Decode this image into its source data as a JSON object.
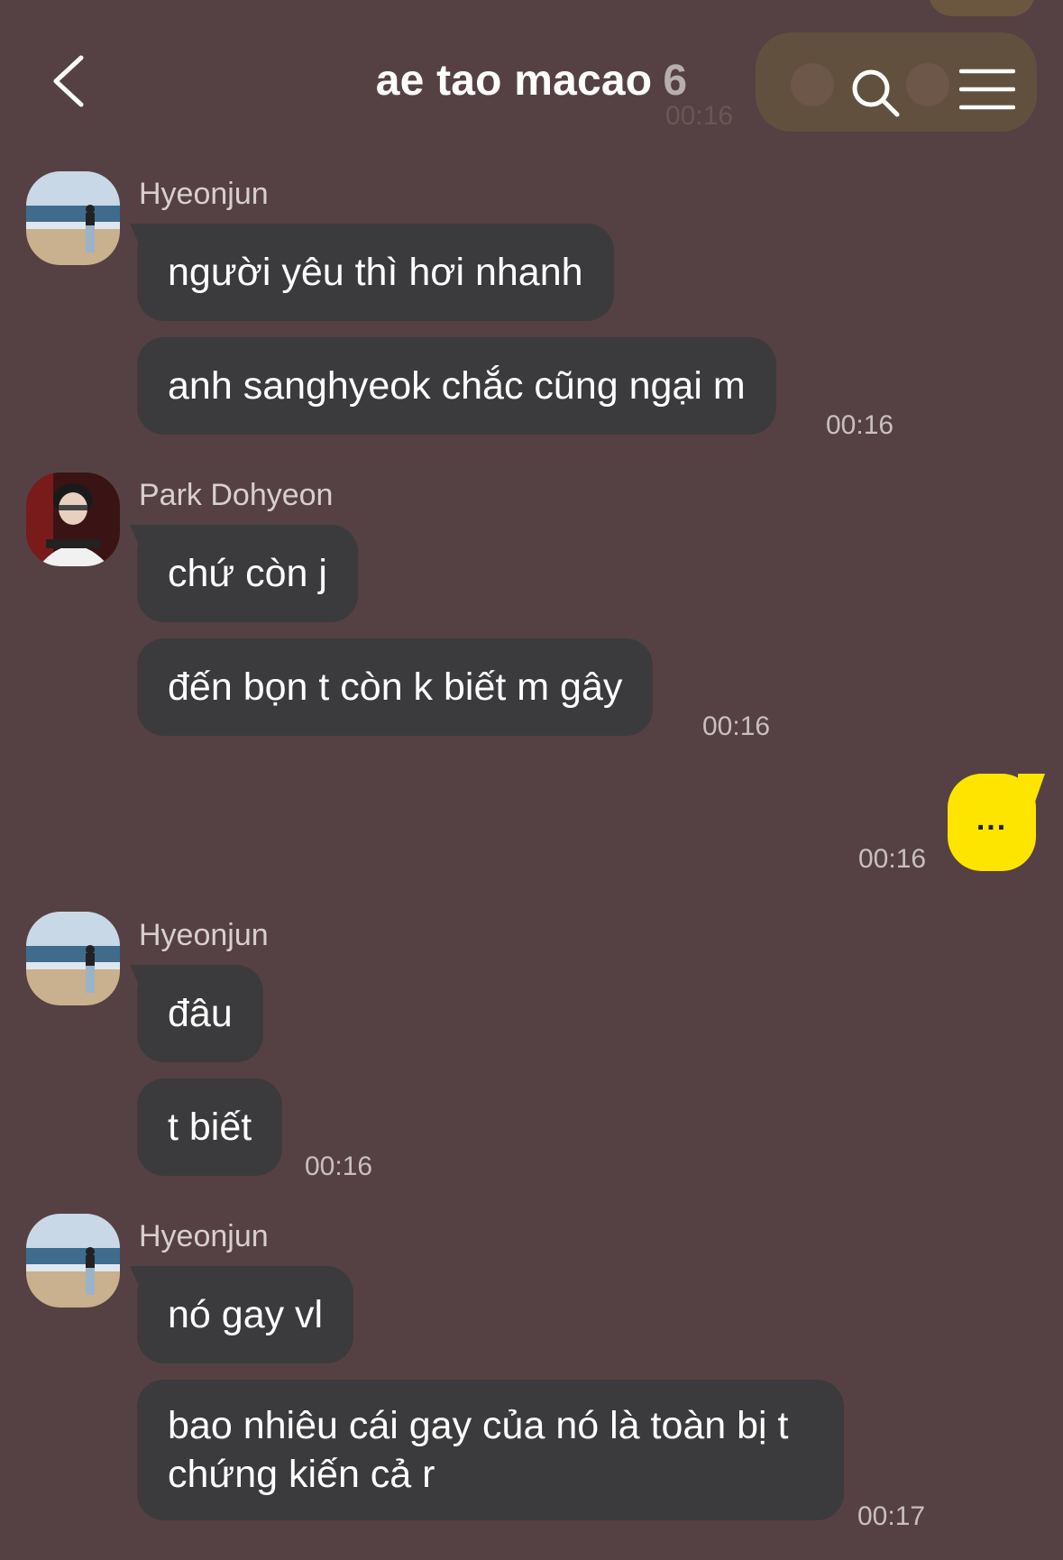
{
  "header": {
    "title": "ae tao macao",
    "member_count": "6",
    "faded_time": "00:16"
  },
  "messages": [
    {
      "sender": "Hyeonjun",
      "avatar": "beach-avatar",
      "lines": [
        "người yêu thì hơi nhanh",
        "anh sanghyeok chắc cũng ngại m"
      ],
      "time": "00:16"
    },
    {
      "sender": "Park Dohyeon",
      "avatar": "person-avatar",
      "lines": [
        "chứ còn j",
        "đến bọn t còn k biết m gây"
      ],
      "time": "00:16"
    },
    {
      "sender": "me",
      "lines": [
        "..."
      ],
      "time": "00:16"
    },
    {
      "sender": "Hyeonjun",
      "avatar": "beach-avatar",
      "lines": [
        "đâu",
        "t biết"
      ],
      "time": "00:16"
    },
    {
      "sender": "Hyeonjun",
      "avatar": "beach-avatar",
      "lines": [
        "nó gay vl",
        "bao nhiêu cái gay của nó là toàn bị t chứng kiến cả r"
      ],
      "time": "00:17"
    }
  ],
  "colors": {
    "background": "#554143",
    "bubble_other": "#3b3b3d",
    "bubble_mine": "#fee500"
  },
  "icons": [
    "back-chevron-icon",
    "search-icon",
    "menu-icon"
  ]
}
